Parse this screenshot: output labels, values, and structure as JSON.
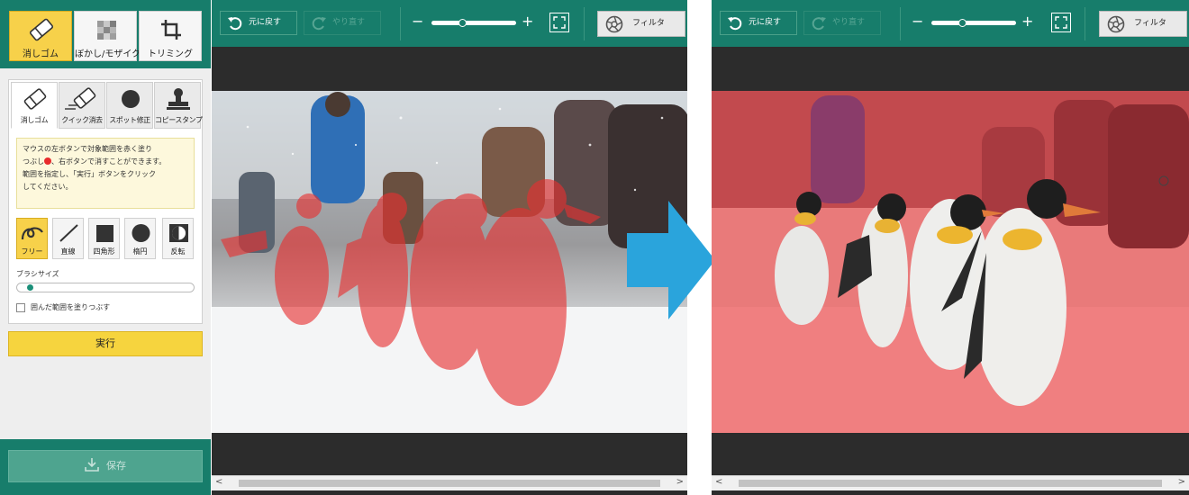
{
  "side_panel": {
    "mode_tools": [
      {
        "label": "消しゴム",
        "icon": "eraser-icon",
        "active": true
      },
      {
        "label": "ぼかし/モザイク",
        "icon": "mosaic-icon",
        "active": false
      },
      {
        "label": "トリミング",
        "icon": "crop-icon",
        "active": false
      }
    ],
    "subtabs": [
      {
        "label": "消しゴム",
        "icon": "eraser-icon",
        "active": true
      },
      {
        "label": "クイック消去",
        "icon": "quick-erase-icon",
        "active": false
      },
      {
        "label": "スポット修正",
        "icon": "spot-fix-icon",
        "active": false
      },
      {
        "label": "コピースタンプ",
        "icon": "stamp-icon",
        "active": false
      }
    ],
    "note": {
      "line1": "マウスの左ボタンで対象範囲を赤く塗り",
      "line2a": "つぶし",
      "line2b": "、右ボタンで消すことができます。",
      "line3": "範囲を指定し、「実行」ボタンをクリック",
      "line4": "してください。"
    },
    "brush_tools": [
      {
        "label": "フリー",
        "icon": "free-draw-icon",
        "active": true
      },
      {
        "label": "直線",
        "icon": "line-icon",
        "active": false
      },
      {
        "label": "四角形",
        "icon": "rectangle-icon",
        "active": false
      },
      {
        "label": "楕円",
        "icon": "ellipse-icon",
        "active": false
      },
      {
        "label": "反転",
        "icon": "invert-icon",
        "active": false
      }
    ],
    "brush_size_label": "ブラシサイズ",
    "brush_size_fraction": 0.05,
    "fill_checkbox_label": "囲んだ範囲を塗りつぶす",
    "fill_checkbox_checked": false,
    "run_label": "実行",
    "save_label": "保存"
  },
  "toolbar": {
    "undo_label": "元に戻す",
    "redo_label": "やり直す",
    "zoom_minus": "−",
    "zoom_plus": "+",
    "zoom_fraction": 0.35,
    "filter_label": "フィルタ"
  },
  "scrollbar": {
    "left_arrow": "<",
    "right_arrow": ">"
  },
  "colors": {
    "header_green": "#177d6b",
    "active_yellow": "#f7d14a",
    "run_yellow": "#f6d43e",
    "selection_red": "#e82b2b",
    "arrow_blue": "#2aa4dc"
  }
}
